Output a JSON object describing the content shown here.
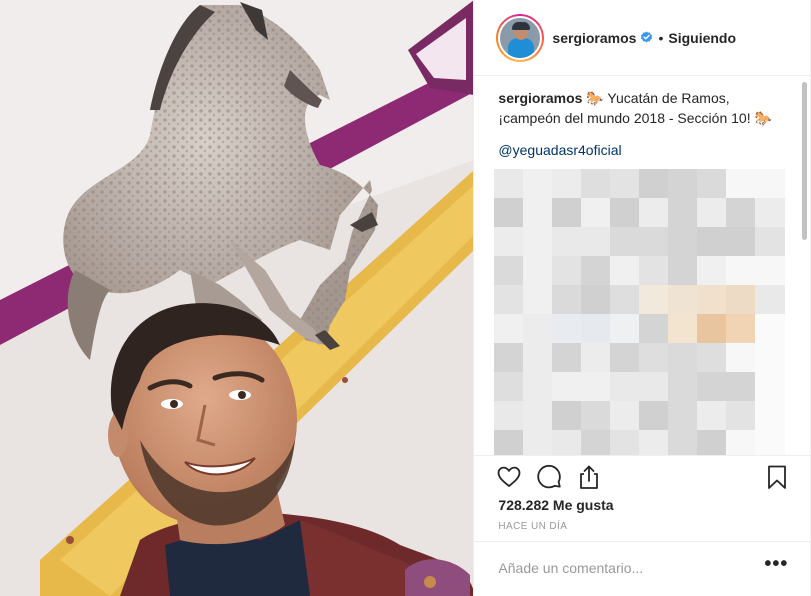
{
  "header": {
    "username": "sergioramos",
    "separator": "•",
    "follow_state": "Siguiendo"
  },
  "caption": {
    "username": "sergioramos",
    "text_part1": "🐎 Yucatán de Ramos, ¡campeón del mundo 2018 - Sección 10! 🐎",
    "mention": "@yeguadasr4oficial"
  },
  "stats": {
    "likes": "728.282 Me gusta",
    "timestamp": "HACE UN DÍA"
  },
  "comment": {
    "placeholder": "Añade un comentario...",
    "more": "•••"
  },
  "colors": {
    "text": "#262626",
    "link": "#003569",
    "muted": "#999999",
    "verified_blue": "#3897f0",
    "border": "#efefef"
  },
  "icons": {
    "verified": "verified-badge-icon",
    "like": "heart-icon",
    "comment": "comment-bubble-icon",
    "share": "share-icon",
    "save": "bookmark-icon",
    "more": "more-options-icon"
  }
}
